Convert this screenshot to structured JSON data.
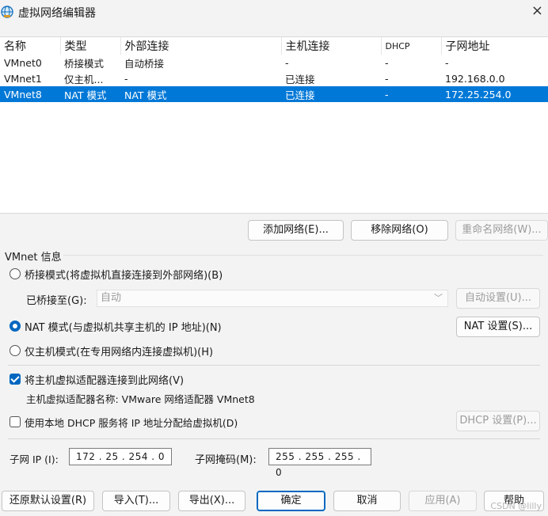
{
  "window": {
    "title": "虚拟网络编辑器",
    "close_label": "×"
  },
  "table": {
    "headers": [
      "名称",
      "类型",
      "外部连接",
      "主机连接",
      "DHCP",
      "子网地址"
    ],
    "rows": [
      [
        "VMnet0",
        "桥接模式",
        "自动桥接",
        "-",
        "-",
        "-"
      ],
      [
        "VMnet1",
        "仅主机...",
        "-",
        "已连接",
        "-",
        "192.168.0.0"
      ],
      [
        "VMnet8",
        "NAT 模式",
        "NAT 模式",
        "已连接",
        "-",
        "172.25.254.0"
      ]
    ],
    "selected_row": 2
  },
  "list_buttons": {
    "add": "添加网络(E)...",
    "remove": "移除网络(O)",
    "rename": "重命名网络(W)..."
  },
  "vmnet_info": {
    "group_title": "VMnet 信息",
    "bridge_radio": "桥接模式(将虚拟机直接连接到外部网络)(B)",
    "bridged_to_label": "已桥接至(G):",
    "bridged_to_value": "自动",
    "auto_settings": "自动设置(U)...",
    "nat_radio": "NAT 模式(与虚拟机共享主机的 IP 地址)(N)",
    "nat_settings": "NAT 设置(S)...",
    "host_only_radio": "仅主机模式(在专用网络内连接虚拟机)(H)",
    "selected_mode": "nat",
    "connect_adapter_label": "将主机虚拟适配器连接到此网络(V)",
    "connect_adapter_checked": true,
    "adapter_name_label": "主机虚拟适配器名称: VMware 网络适配器 VMnet8",
    "dhcp_label": "使用本地 DHCP 服务将 IP 地址分配给虚拟机(D)",
    "dhcp_checked": false,
    "dhcp_settings": "DHCP 设置(P)...",
    "subnet_ip_label": "子网 IP (I):",
    "subnet_ip_value": "172 . 25 . 254 . 0",
    "subnet_mask_label": "子网掩码(M):",
    "subnet_mask_value": "255 . 255 . 255 . 0"
  },
  "footer_buttons": {
    "restore": "还原默认设置(R)",
    "import": "导入(T)...",
    "export": "导出(X)...",
    "ok": "确定",
    "cancel": "取消",
    "apply": "应用(A)",
    "help": "帮助"
  },
  "watermark": "CSDN @lilly",
  "colors": {
    "accent": "#0078d7",
    "selection": "#0078d7"
  }
}
